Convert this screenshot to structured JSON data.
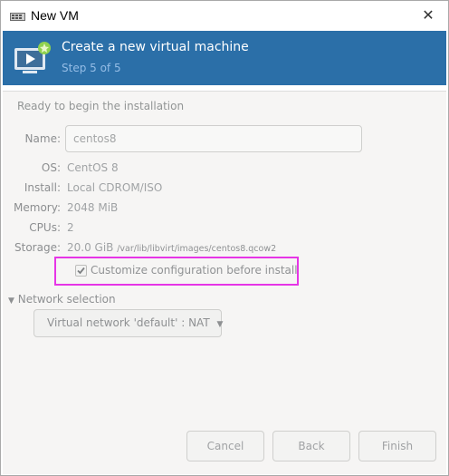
{
  "window": {
    "title": "New VM",
    "close_glyph": "✕"
  },
  "header": {
    "title": "Create a new virtual machine",
    "step": "Step 5 of 5"
  },
  "summary": {
    "ready_text": "Ready to begin the installation",
    "name_label": "Name:",
    "name_value": "centos8",
    "os_label": "OS:",
    "os_value": "CentOS 8",
    "install_label": "Install:",
    "install_value": "Local CDROM/ISO",
    "memory_label": "Memory:",
    "memory_value": "2048 MiB",
    "cpus_label": "CPUs:",
    "cpus_value": "2",
    "storage_label": "Storage:",
    "storage_size": "20.0 GiB",
    "storage_path": "/var/lib/libvirt/images/centos8.qcow2"
  },
  "customize": {
    "label": "Customize configuration before install",
    "checked": true
  },
  "network": {
    "section_label": "Network selection",
    "selected": "Virtual network 'default' : NAT"
  },
  "buttons": {
    "cancel": "Cancel",
    "back": "Back",
    "finish": "Finish"
  },
  "colors": {
    "header_bg": "#2b6fa8",
    "highlight_border": "#e635e6"
  }
}
